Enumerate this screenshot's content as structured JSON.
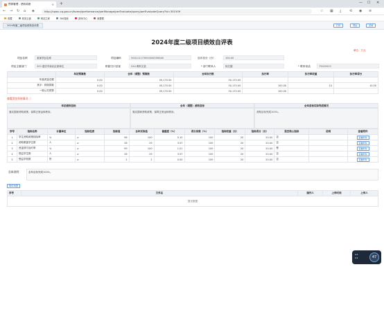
{
  "browser": {
    "tab_title": "预算管理 - 绩效填报",
    "url": "http://cpwc.cq.gov.cn/home/performance/perManage/perEvaluate/query/perEvaluateQuery?id=301509",
    "bookmarks": [
      "收藏",
      "政务云盘",
      "网站之家",
      "360搜索",
      "游戏中心",
      "我要看"
    ]
  },
  "app": {
    "tab_label": "2024年度二级项目绩效自评表",
    "btn_print": "打印",
    "btn_export": "导出",
    "btn_close": "关闭"
  },
  "doc": {
    "title": "2024年度二级项目绩效自评表",
    "unit_label": "单位：万元"
  },
  "info": {
    "project_name_label": "项目名称",
    "project_name": "某某项目名称",
    "project_code_label": "项目编码",
    "project_code": "500112173000000056548",
    "self_score_label": "自评总分（分）",
    "self_score": "100.00",
    "dept_label": "项目主管部门",
    "dept": "500 重庆市渝北区某单位",
    "org_label": "职能归口处室",
    "org": "0X4-教科文处",
    "contact_label": "* 部门联系人",
    "contact": "徐文婕",
    "phone_label": "* 联系电话",
    "phone": "79020023"
  },
  "budget": {
    "headers": [
      "年初预算数",
      "全年（调整）预算数",
      "全年执行数",
      "执行率",
      "执行率权重",
      "执行率得分"
    ],
    "rows": [
      {
        "label": "年度资金总额",
        "v1": "0.00",
        "v2": "50,170.00",
        "v3": "50,170.00",
        "v4": "",
        "v5": "",
        "v6": ""
      },
      {
        "label": "其中：财政拨款",
        "v1": "0.00",
        "v2": "50,170.00",
        "v3": "50,170.00",
        "v4": "100.00",
        "v5": "10",
        "v6": "10.00"
      },
      {
        "label": "一般公共预算",
        "v1": "0.00",
        "v2": "50,170.00",
        "v3": "50,170.00",
        "v4": "100.00",
        "v5": "",
        "v6": ""
      }
    ]
  },
  "section_red": "查看资金到账情况 ⓘ",
  "goals": {
    "h1": "年初绩效目标",
    "h2": "全年（调整）绩效目标",
    "h3": "全年目标实际完成情况",
    "t1": "落实国家资助政策，保障正常运转秩序。",
    "t2": "落实国家资助政策，保障正常运转秩序。",
    "t3": "资助目标完成100%。"
  },
  "indicators": {
    "headers": [
      "序号",
      "指标名称",
      "计量单位",
      "指标性质",
      "指标值",
      "全年实际值",
      "偏差度（%）",
      "得分系数（%）",
      "指标权重（分）",
      "指标得分（分）",
      "是否核心指标",
      "说明",
      "查看附件"
    ],
    "view_label": "查看附件",
    "rows": [
      [
        "1",
        "学生资助政策知晓率",
        "%",
        "≥",
        "98",
        "100",
        "0.10",
        "100",
        "20",
        "20.00",
        "否"
      ],
      [
        "2",
        "资助覆盖学生数",
        "人",
        "≥",
        "28",
        "29",
        "3.57",
        "100",
        "20",
        "20.00",
        "否"
      ],
      [
        "3",
        "资金拨付及时率",
        "%",
        "≥",
        "99",
        "100",
        "1.01",
        "100",
        "20",
        "20.00",
        "是"
      ],
      [
        "4",
        "受益学生数",
        "人",
        "≥",
        "28",
        "29",
        "3.57",
        "100",
        "20",
        "20.00",
        "否"
      ],
      [
        "5",
        "受益学校数",
        "所",
        "≥",
        "2",
        "2",
        "0.00",
        "100",
        "20",
        "20.00",
        "否"
      ]
    ]
  },
  "notes": {
    "label": "总体说明：",
    "text": "全年目标完成100%。"
  },
  "attachments": {
    "button": "附件列表",
    "headers": [
      "序号",
      "文件名",
      "操作人",
      "上传时间",
      "上传人"
    ],
    "empty": "暂无数据"
  },
  "widget": {
    "line1": "0.5",
    "line2": "0.5",
    "value": "47"
  }
}
